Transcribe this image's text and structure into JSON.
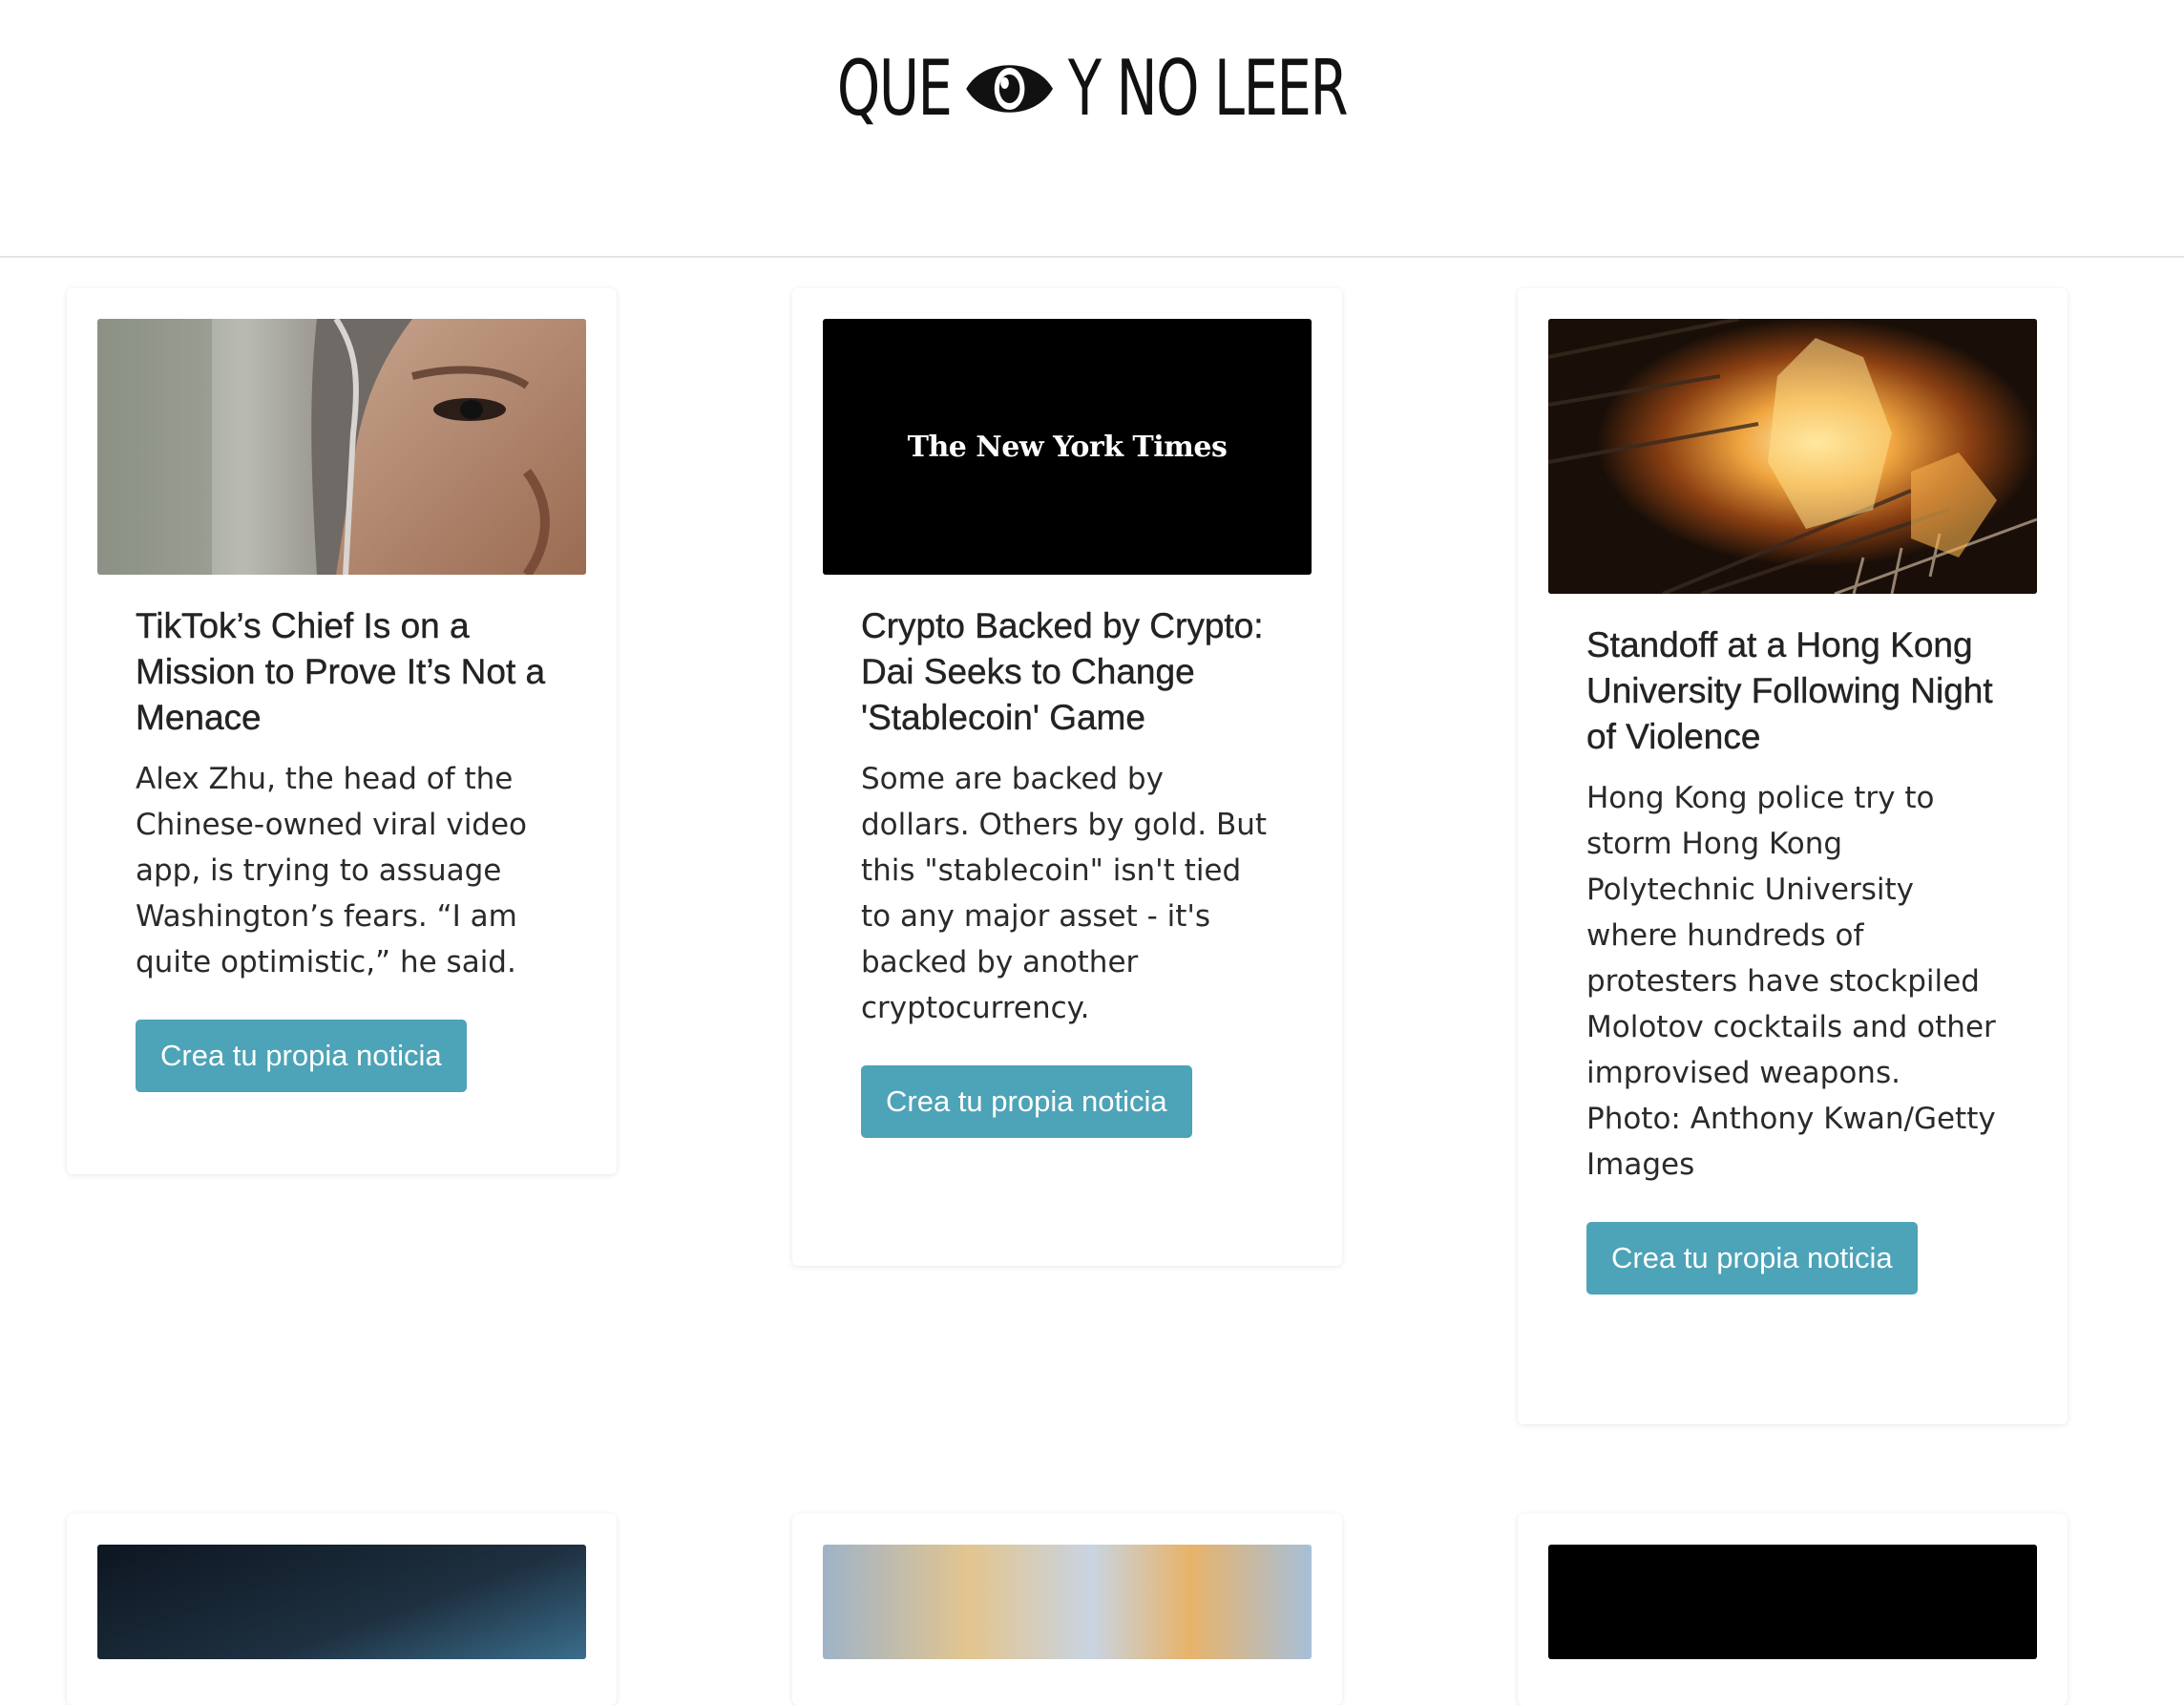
{
  "site": {
    "logo_left": "QUE",
    "logo_right": "Y NO LEER",
    "logo_icon": "eye-icon"
  },
  "cards": [
    {
      "image": "portrait-photo",
      "title": "TikTok’s Chief Is on a Mission to Prove It’s Not a Menace",
      "description": "Alex Zhu, the head of the Chinese-owned viral video app, is trying to assuage Washington’s fears. “I am quite optimistic,” he said.",
      "button": "Crea tu propia noticia"
    },
    {
      "image": "nyt-logo",
      "image_text": "The New York Times",
      "title": "Crypto Backed by Crypto: Dai Seeks to Change 'Stablecoin' Game",
      "description": "Some are backed by dollars. Others by gold. But this \"stablecoin\" isn't tied to any major asset - it's backed by another cryptocurrency.",
      "button": "Crea tu propia noticia"
    },
    {
      "image": "fire-photo",
      "title": "Standoff at a Hong Kong University Following Night of Violence",
      "description": "Hong Kong police try to storm Hong Kong Polytechnic University where hundreds of protesters have stockpiled Molotov cocktails and other improvised weapons. Photo: Anthony Kwan/Getty Images",
      "button": "Crea tu propia noticia"
    }
  ],
  "colors": {
    "button": "#4da3b7",
    "divider": "#e3e4e6"
  }
}
